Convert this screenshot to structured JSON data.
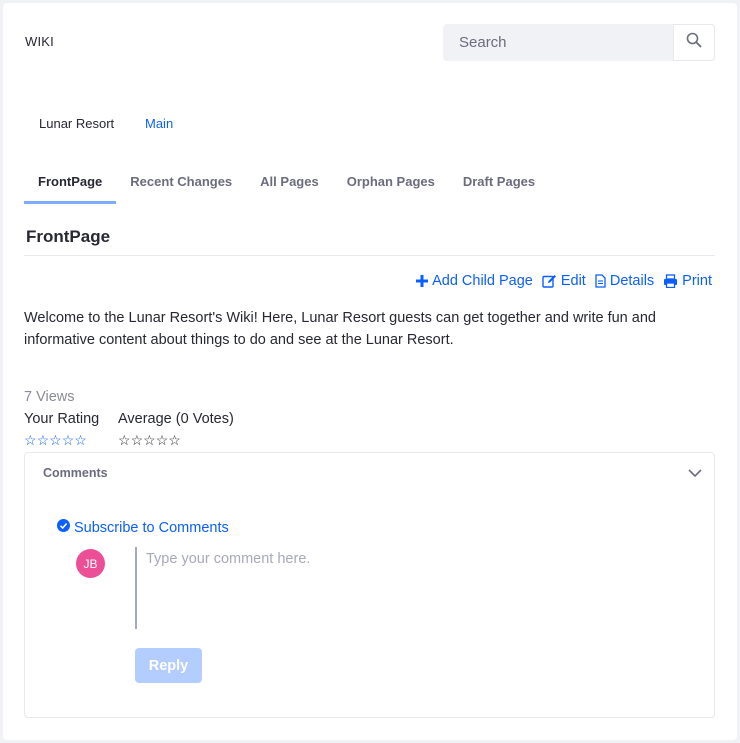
{
  "portlet": {
    "title": "WIKI"
  },
  "search": {
    "placeholder": "Search",
    "icon": "search-icon"
  },
  "nodes": {
    "lunar": "Lunar Resort",
    "main": "Main"
  },
  "tabs": [
    {
      "label": "FrontPage",
      "active": true
    },
    {
      "label": "Recent Changes"
    },
    {
      "label": "All Pages"
    },
    {
      "label": "Orphan Pages"
    },
    {
      "label": "Draft Pages"
    }
  ],
  "page": {
    "title": "FrontPage",
    "content": "Welcome to the Lunar Resort's Wiki! Here, Lunar Resort guests can get together and write fun and informative content about things to do and see at the Lunar Resort."
  },
  "actions": {
    "add_child": "Add Child Page",
    "edit": "Edit",
    "details": "Details",
    "print": "Print"
  },
  "stats": {
    "views": "7 Views",
    "your_rating": "Your Rating",
    "average": "Average (0 Votes)",
    "user_stars": "☆☆☆☆☆",
    "avg_stars": "☆☆☆☆☆"
  },
  "comments": {
    "title": "Comments",
    "subscribe": "Subscribe to Comments",
    "avatar_initials": "JB",
    "placeholder": "Type your comment here.",
    "reply": "Reply"
  },
  "colors": {
    "accent": "#0b5fff",
    "avatar": "#ed4f96",
    "reply_disabled": "#b3cdff"
  }
}
